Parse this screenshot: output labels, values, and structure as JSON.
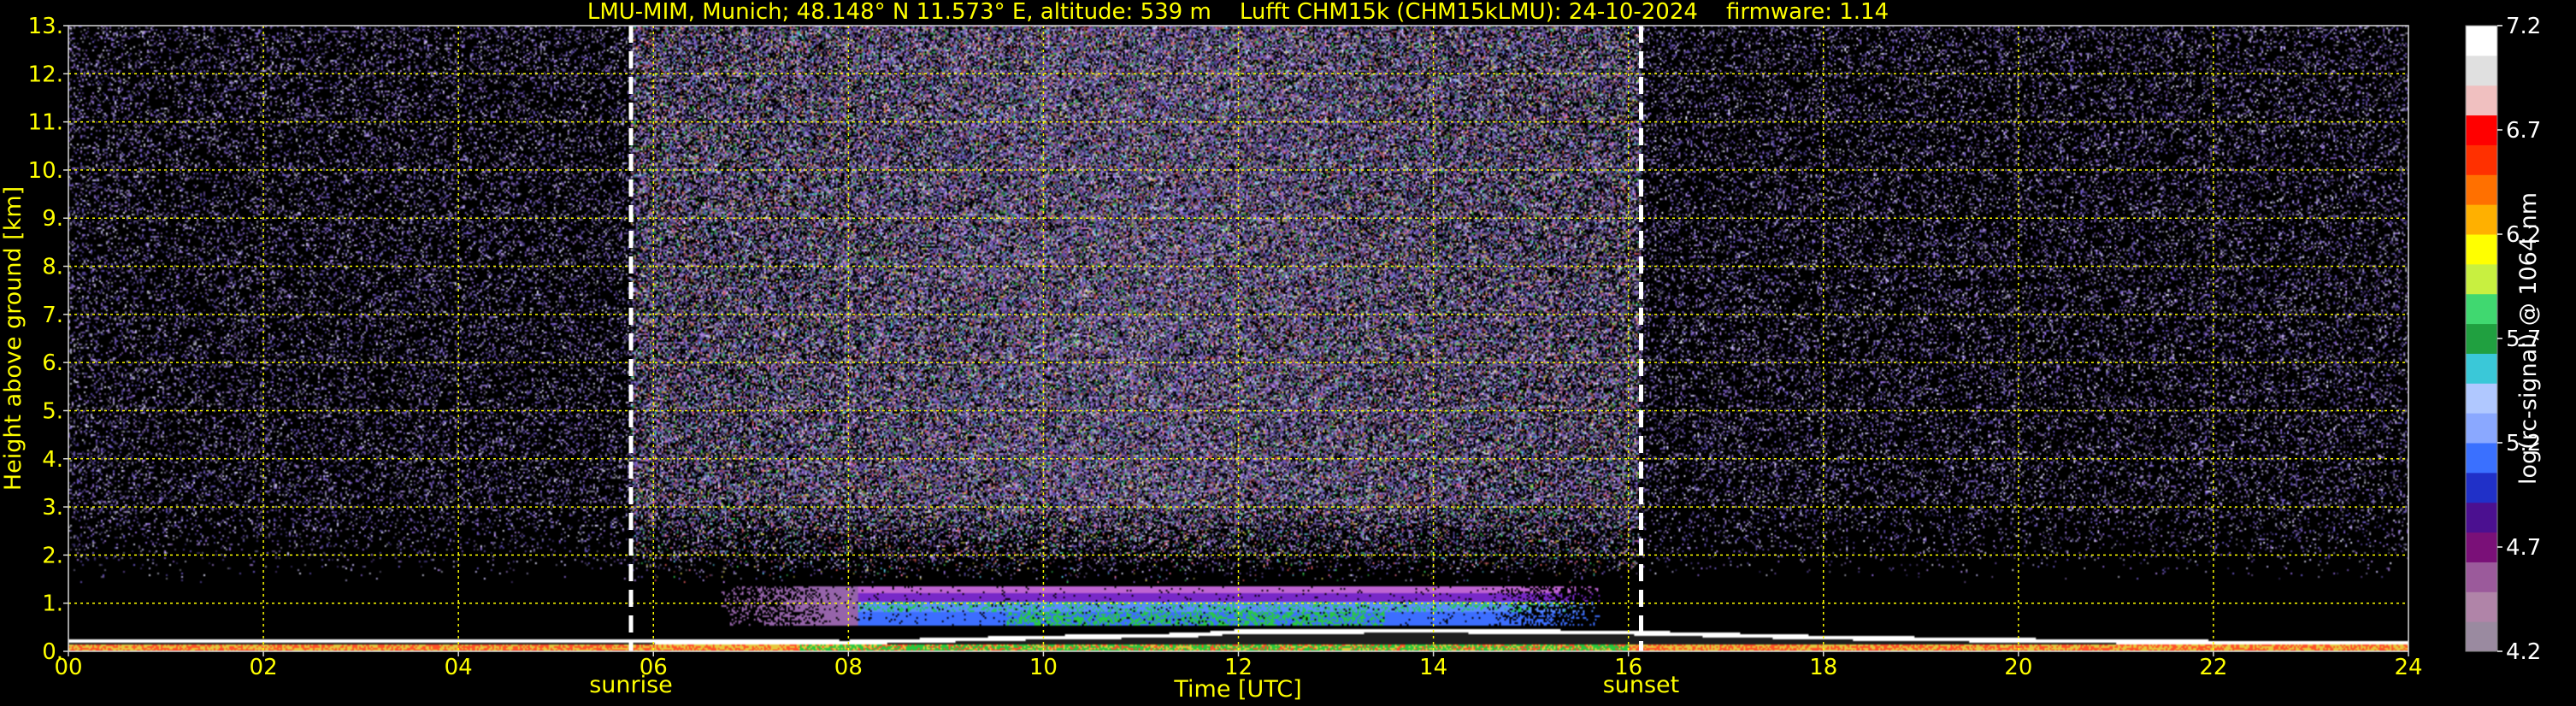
{
  "title": "LMU-MIM, Munich; 48.148° N 11.573° E, altitude: 539 m    Lufft CHM15k (CHM15kLMU): 24-10-2024    firmware: 1.14",
  "chart_data": {
    "type": "heatmap",
    "xlabel": "Time [UTC]",
    "ylabel": "Height above ground [km]",
    "xlim": [
      0,
      24
    ],
    "ylim": [
      0,
      13
    ],
    "x_ticks": [
      "00",
      "02",
      "04",
      "06",
      "08",
      "10",
      "12",
      "14",
      "16",
      "18",
      "20",
      "22",
      "24"
    ],
    "y_ticks": [
      "0.",
      "1.",
      "2.",
      "3.",
      "4.",
      "5.",
      "6.",
      "7.",
      "8.",
      "9.",
      "10.",
      "11.",
      "12.",
      "13."
    ],
    "grid": true,
    "events": [
      {
        "label": "sunrise",
        "time": 5.77
      },
      {
        "label": "sunset",
        "time": 16.13
      }
    ],
    "colorbar": {
      "label": "log(rc-signal) @ 1064 nm",
      "ticks": [
        "4.2",
        "4.7",
        "5.2",
        "5.7",
        "6.2",
        "6.7",
        "7.2"
      ],
      "range": [
        4.2,
        7.2
      ]
    },
    "features": {
      "boundary_layer_top_km": [
        [
          0.0,
          0.2
        ],
        [
          2.0,
          0.2
        ],
        [
          4.0,
          0.21
        ],
        [
          6.0,
          0.2
        ],
        [
          8.0,
          0.18
        ],
        [
          10.0,
          0.28
        ],
        [
          11.5,
          0.33
        ],
        [
          12.0,
          0.4
        ],
        [
          14.0,
          0.42
        ],
        [
          16.0,
          0.38
        ],
        [
          18.0,
          0.28
        ],
        [
          20.0,
          0.22
        ],
        [
          22.0,
          0.18
        ],
        [
          24.0,
          0.17
        ]
      ],
      "aerosol_layer": {
        "start": 6.7,
        "end": 15.7,
        "base_km": 0.55,
        "top_km": 1.35
      }
    }
  },
  "colors": {
    "axis_text": "#ffff00",
    "grid": "#ffff00",
    "background": "#000000",
    "event_line": "#ffffff",
    "colormap": [
      "#9a8aa0",
      "#b084a8",
      "#9b5a9b",
      "#7a1078",
      "#4b1090",
      "#2030c8",
      "#3a70ff",
      "#8aa8ff",
      "#b0c8ff",
      "#3ac8d8",
      "#20a040",
      "#40d870",
      "#c8f040",
      "#ffff00",
      "#ffb000",
      "#ff7000",
      "#ff3000",
      "#ff0000",
      "#f0c0c0",
      "#e0e0e0",
      "#ffffff"
    ]
  }
}
